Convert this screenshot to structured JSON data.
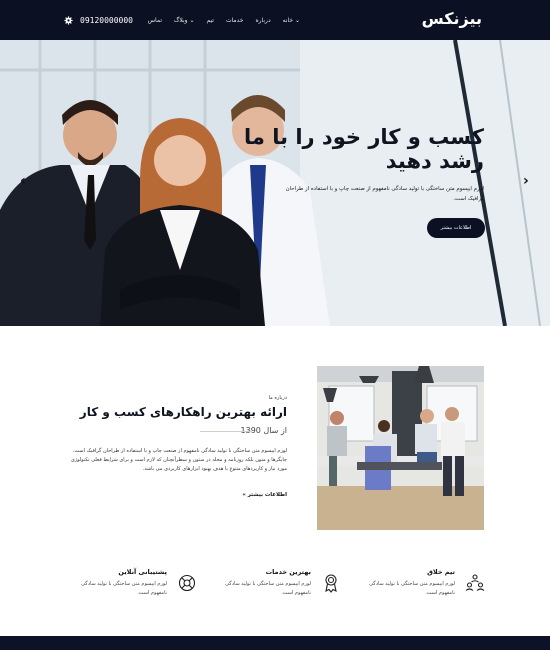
{
  "header": {
    "logo": "بیزنکس",
    "nav": [
      "خانه",
      "درباره",
      "خدمات",
      "تیم",
      "وبلاگ",
      "تماس"
    ],
    "phone": "09120000000",
    "nav_dropdown_marks": [
      "خانه",
      "وبلاگ"
    ]
  },
  "hero": {
    "title": "کسب و کار خود را با ما رشد دهید",
    "text": "لورم ایپسوم متن ساختگی با تولید سادگی نامفهوم از صنعت چاپ و با استفاده از طراحان گرافیک است.",
    "button": "اطلاعات بیشتر"
  },
  "about": {
    "kicker": "درباره ما",
    "title": "ارائه بهترین راهکارهای کسب و کار",
    "since": "از سال 1390",
    "text": "لورم ایپسوم متن ساختگی با تولید سادگی نامفهوم از صنعت چاپ و با استفاده از طراحان گرافیک است. چاپگرها و متون بلکه روزنامه و مجله در ستون و سطرآنچنان که لازم است و برای شرایط فعلی تکنولوژی مورد نیاز و کاربردهای متنوع با هدف بهبود ابزارهای کاربردی می باشد.",
    "link": "اطلاعات بیشتر »"
  },
  "features": [
    {
      "title": "تیم خلاق",
      "desc": "لورم ایپسوم متن ساختگی با تولید سادگی نامفهوم است.",
      "icon": "team-icon"
    },
    {
      "title": "بهترین خدمات",
      "desc": "لورم ایپسوم متن ساختگی با تولید سادگی نامفهوم است.",
      "icon": "award-icon"
    },
    {
      "title": "پشتیبانی آنلاین",
      "desc": "لورم ایپسوم متن ساختگی با تولید سادگی نامفهوم است.",
      "icon": "support-icon"
    }
  ],
  "colors": {
    "header_bg": "#0b1023",
    "button_bg": "#0b1023",
    "accent_text": "#0f1420"
  }
}
